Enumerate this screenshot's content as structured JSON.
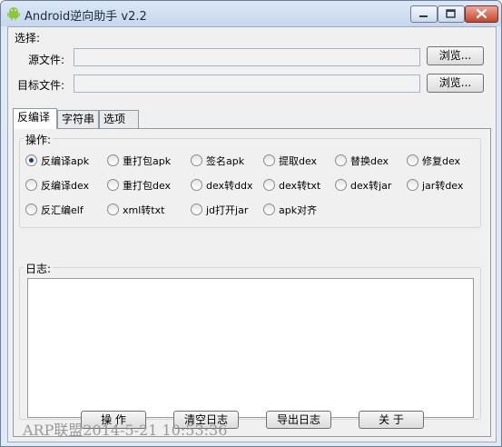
{
  "window": {
    "title": "Android逆向助手 v2.2"
  },
  "select_section": {
    "heading": "选择:",
    "source_label": "源文件:",
    "source_value": "",
    "target_label": "目标文件:",
    "target_value": "",
    "browse_label": "浏览..."
  },
  "tabs": [
    {
      "label": "反编译",
      "active": true
    },
    {
      "label": "字符串",
      "active": false
    },
    {
      "label": "选项",
      "active": false
    }
  ],
  "operations": {
    "heading": "操作:",
    "items": [
      {
        "label": "反编译apk",
        "checked": true
      },
      {
        "label": "重打包apk",
        "checked": false
      },
      {
        "label": "签名apk",
        "checked": false
      },
      {
        "label": "提取dex",
        "checked": false
      },
      {
        "label": "替换dex",
        "checked": false
      },
      {
        "label": "修复dex",
        "checked": false
      },
      {
        "label": "反编译dex",
        "checked": false
      },
      {
        "label": "重打包dex",
        "checked": false
      },
      {
        "label": "dex转ddx",
        "checked": false
      },
      {
        "label": "dex转txt",
        "checked": false
      },
      {
        "label": "dex转jar",
        "checked": false
      },
      {
        "label": "jar转dex",
        "checked": false
      },
      {
        "label": "反汇编elf",
        "checked": false
      },
      {
        "label": "xml转txt",
        "checked": false
      },
      {
        "label": "jd打开jar",
        "checked": false
      },
      {
        "label": "apk对齐",
        "checked": false
      }
    ]
  },
  "log": {
    "heading": "日志:",
    "content": ""
  },
  "buttons": {
    "operate": "操  作",
    "clear_log": "清空日志",
    "export_log": "导出日志",
    "about": "关  于"
  },
  "watermark": "ARP联盟2014-5-21 10:53:36",
  "colors": {
    "title_gradient_top": "#dbe7f5",
    "close_button": "#c7452d",
    "radio_selected": "#1a3f7a"
  }
}
